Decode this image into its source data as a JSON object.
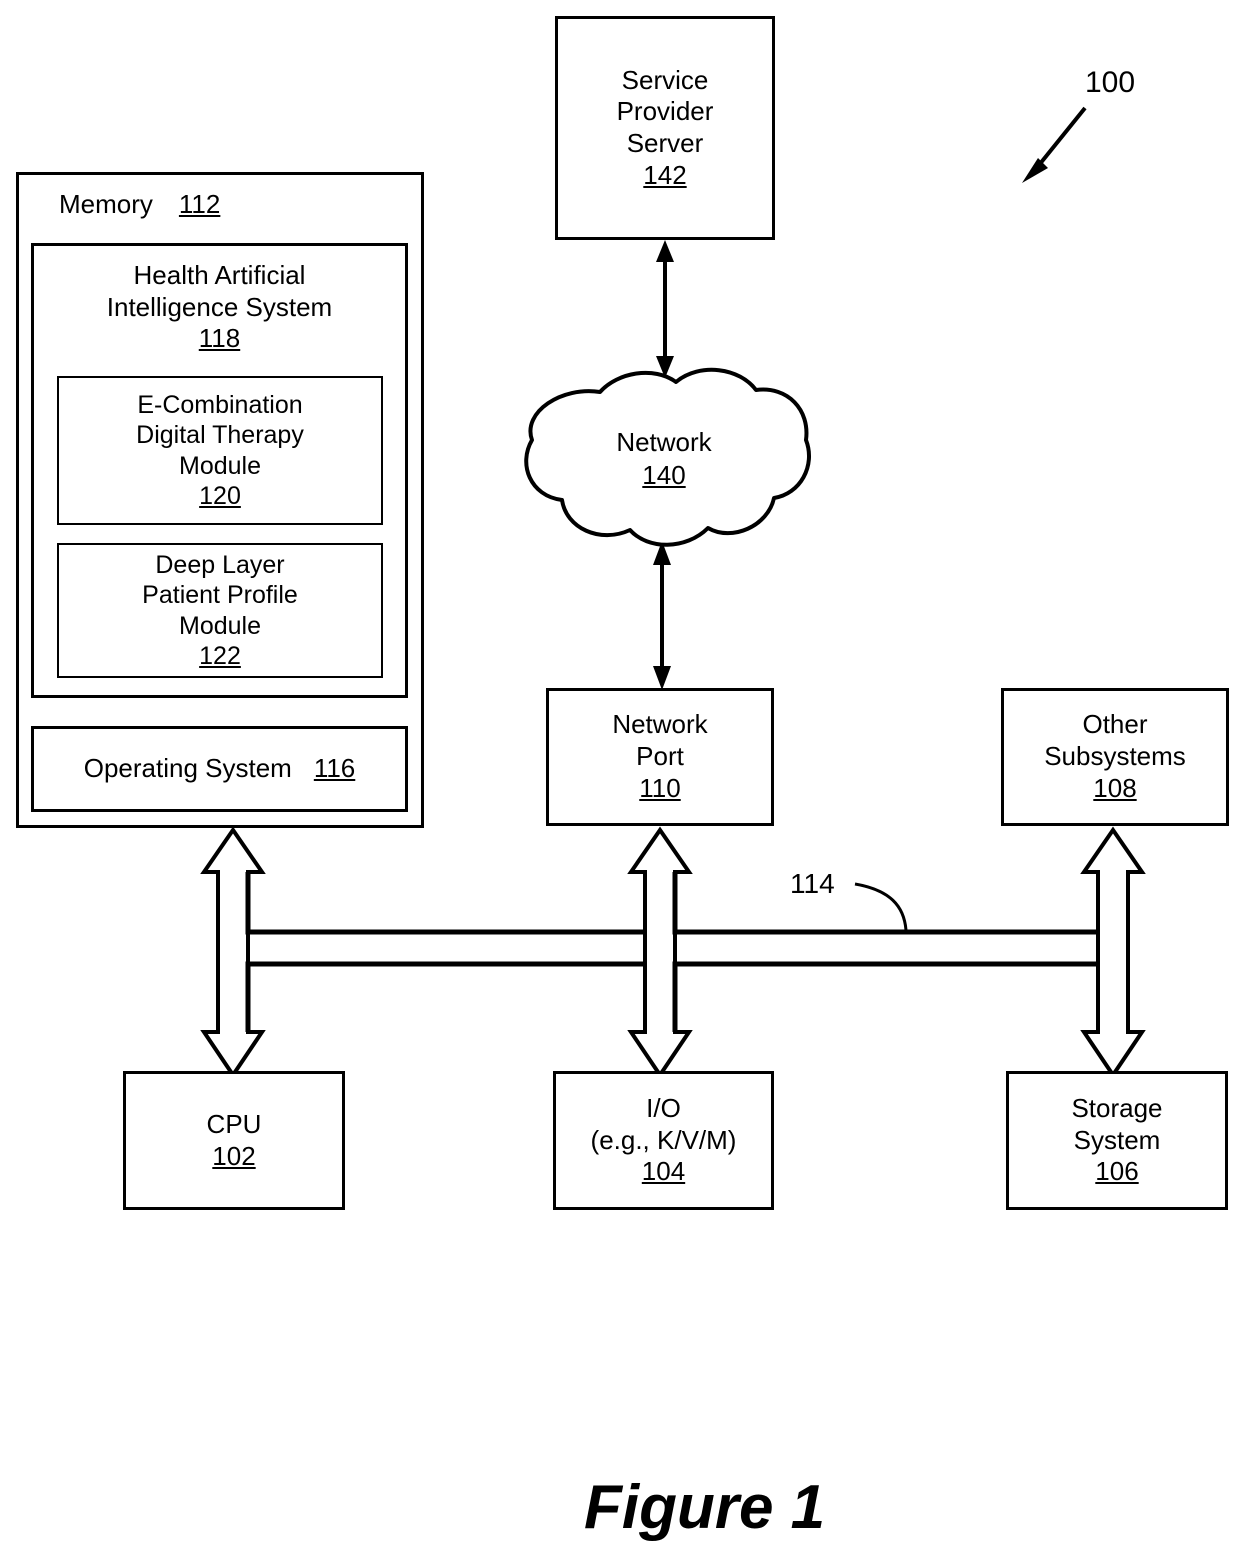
{
  "figure": {
    "caption": "Figure 1",
    "system_ref": "100",
    "bus_ref": "114"
  },
  "memory": {
    "title": "Memory",
    "ref": "112",
    "hai_system": {
      "line1": "Health Artificial",
      "line2": "Intelligence System",
      "ref": "118",
      "modules": [
        {
          "line1": "E-Combination",
          "line2": "Digital Therapy",
          "line3": "Module",
          "ref": "120"
        },
        {
          "line1": "Deep Layer",
          "line2": "Patient Profile",
          "line3": "Module",
          "ref": "122"
        }
      ]
    },
    "operating_system": {
      "label": "Operating System",
      "ref": "116"
    }
  },
  "nodes": {
    "service_provider_server": {
      "line1": "Service",
      "line2": "Provider",
      "line3": "Server",
      "ref": "142"
    },
    "network_cloud": {
      "label": "Network",
      "ref": "140"
    },
    "network_port": {
      "line1": "Network",
      "line2": "Port",
      "ref": "110"
    },
    "other_subsystems": {
      "line1": "Other",
      "line2": "Subsystems",
      "ref": "108"
    },
    "cpu": {
      "label": "CPU",
      "ref": "102"
    },
    "io": {
      "line1": "I/O",
      "line2": "(e.g., K/V/M)",
      "ref": "104"
    },
    "storage_system": {
      "line1": "Storage",
      "line2": "System",
      "ref": "106"
    }
  },
  "colors": {
    "stroke": "#000000",
    "background": "#ffffff"
  }
}
